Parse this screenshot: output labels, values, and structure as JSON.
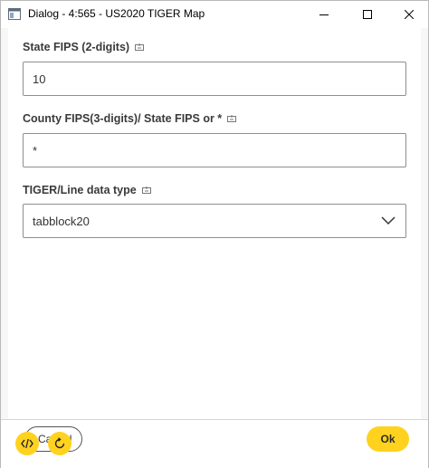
{
  "window": {
    "title": "Dialog - 4:565 - US2020 TIGER Map"
  },
  "form": {
    "state_fips": {
      "label": "State FIPS (2-digits)",
      "value": "10"
    },
    "county_fips": {
      "label": "County FIPS(3-digits)/ State FIPS or *",
      "value": "*"
    },
    "data_type": {
      "label": "TIGER/Line data type",
      "selected": "tabblock20"
    }
  },
  "footer": {
    "cancel_label": "Cancel",
    "ok_label": "Ok"
  },
  "colors": {
    "accent": "#ffd21f"
  }
}
